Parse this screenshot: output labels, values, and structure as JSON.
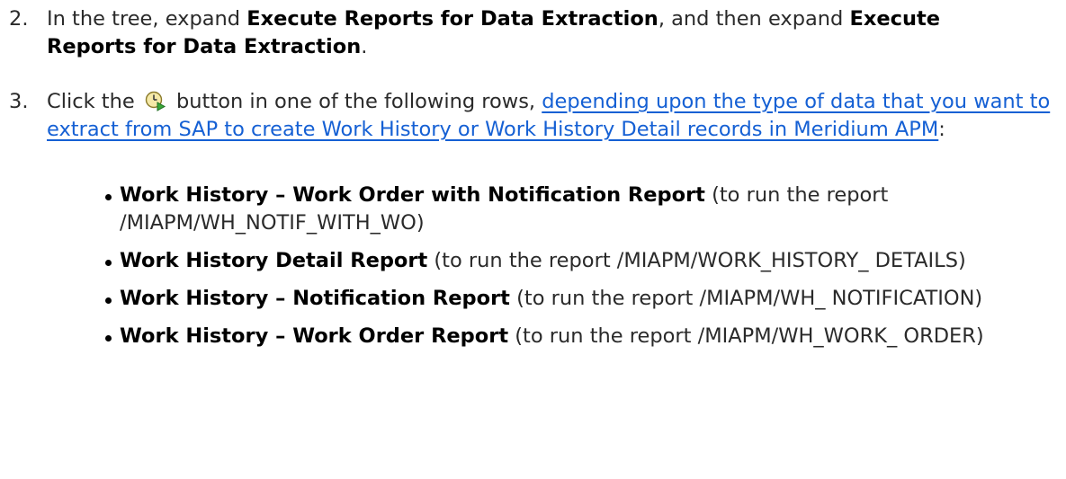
{
  "step2": {
    "number": "2.",
    "text_before": "In the tree, expand ",
    "bold1": "Execute Reports for Data Extraction",
    "text_middle": ", and then expand ",
    "bold2": "Execute",
    "bold2_cont": "Reports for Data Extraction",
    "text_after": "."
  },
  "step3": {
    "number": "3.",
    "text_before": "Click the",
    "icon": "execute-clock-icon",
    "text_after_icon": "button in one of the following rows, ",
    "link_text": "depending upon the type of data that you want to extract from SAP to create Work History or Work History Detail records in Meridium APM",
    "text_end": ":",
    "link_color": "#1560d4"
  },
  "reports": [
    {
      "name": "Work History – Work Order with Notification Report",
      "desc": "(to run the report /MIAPM/WH_NOTIF_WITH_WO)"
    },
    {
      "name": "Work History Detail Report",
      "desc": "(to run the report /MIAPM/WORK_HISTORY_ DETAILS)"
    },
    {
      "name": "Work History – Notification Report",
      "desc": "(to run the report /MIAPM/WH_ NOTIFICATION)"
    },
    {
      "name": "Work History – Work Order Report",
      "desc": "(to run the report /MIAPM/WH_WORK_ ORDER)"
    }
  ]
}
